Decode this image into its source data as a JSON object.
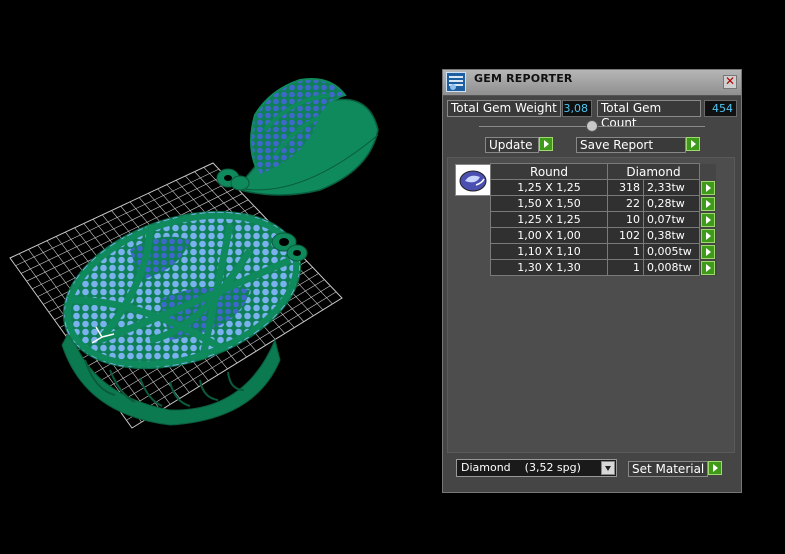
{
  "panel": {
    "title": "GEM REPORTER",
    "close_glyph": "✕",
    "total_weight_label": "Total Gem Weight",
    "total_weight_value": "3,08",
    "total_count_label": "Total Gem Count",
    "total_count_value": "454",
    "update_label": "Update",
    "save_report_label": "Save Report",
    "table": {
      "headers": [
        "Round",
        "Diamond"
      ],
      "rows": [
        {
          "size": "1,25 X 1,25",
          "count": "318",
          "weight": "2,33tw"
        },
        {
          "size": "1,50 X 1,50",
          "count": "22",
          "weight": "0,28tw"
        },
        {
          "size": "1,25 X 1,25",
          "count": "10",
          "weight": "0,07tw"
        },
        {
          "size": "1,00 X 1,00",
          "count": "102",
          "weight": "0,38tw"
        },
        {
          "size": "1,10 X 1,10",
          "count": "1",
          "weight": "0,005tw"
        },
        {
          "size": "1,30 X 1,30",
          "count": "1",
          "weight": "0,008tw"
        }
      ]
    },
    "material_select_value": "Diamond    (3,52 spg)",
    "set_material_label": "Set Material"
  },
  "colors": {
    "metal": "#0f8a5c",
    "gem": "#6fa8e8",
    "gem_dark": "#3354c8",
    "grid": "#bfbfbf",
    "accent_green": "#3f9a1a",
    "value_blue": "#4ec4f0"
  },
  "icons": [
    "gem-reporter-icon",
    "close-icon",
    "play-arrow-icon",
    "dropdown-arrow-icon",
    "round-gem-icon"
  ]
}
